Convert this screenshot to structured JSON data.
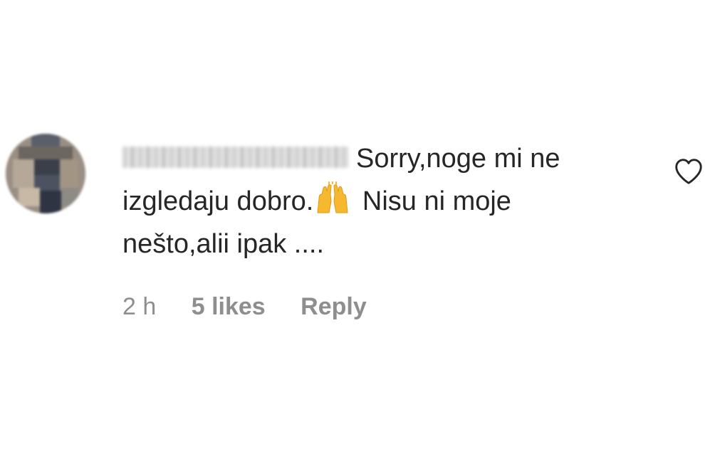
{
  "comment": {
    "username": "emjaojerkanka",
    "text_line1": "Sorry,noge mi ne",
    "text_line2_a": "izgledaju dobro.",
    "emoji": "raising-hands",
    "text_line2_b": " Nisu ni moje",
    "text_line3": "nešto,alii ipak ....",
    "time": "2 h",
    "likes": "5 likes",
    "reply_label": "Reply"
  },
  "colors": {
    "text": "#262626",
    "meta": "#8e8e8e",
    "emoji": "#f5b82e"
  },
  "icons": {
    "like": "heart-outline-icon",
    "avatar": "user-avatar-pixelated"
  }
}
